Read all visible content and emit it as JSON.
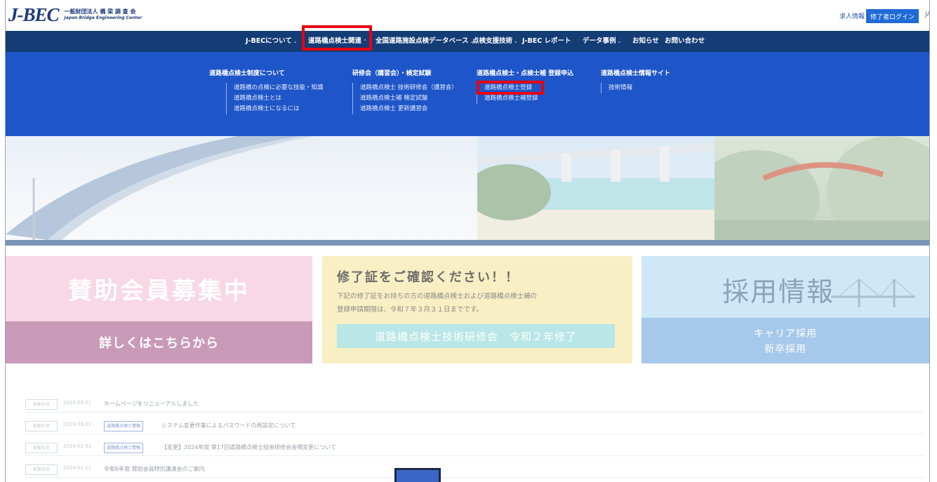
{
  "header": {
    "logo_mark": "J-BEC",
    "logo_jp": "一般財団法人 橋 梁 調 査 会",
    "logo_en": "Japan Bridge Engineering Center",
    "recruit_link": "求人情報",
    "login_button": "修了者ログイン",
    "lang_link": "JA"
  },
  "nav": {
    "items": [
      {
        "label": "J-BECについて",
        "chevron": true
      },
      {
        "label": "道路橋点検士関連",
        "chevron": true,
        "active": true
      },
      {
        "label": "全国道路施設点検データベース",
        "chevron": true
      },
      {
        "label": "点検支援技術",
        "chevron": true
      },
      {
        "label": "J-BEC レポート",
        "chevron": false
      },
      {
        "label": "データ事例",
        "chevron": true
      },
      {
        "label": "お知らせ",
        "chevron": false
      },
      {
        "label": "お問い合わせ",
        "chevron": false
      }
    ]
  },
  "mega_menu": {
    "columns": [
      {
        "heading": "道路橋点検士制度について",
        "items": [
          "道路橋の点検に必要な技能・知識",
          "道路橋点検士とは",
          "道路橋点検士になるには"
        ]
      },
      {
        "heading": "研修会（講習会）・検定試験",
        "items": [
          "道路橋点検士 技術研修会（講習会）",
          "道路橋点検士補 検定試験",
          "道路橋点検士 更新講習会"
        ]
      },
      {
        "heading": "道路橋点検士・点検士補 登録申込",
        "items": [
          "道路橋点検士登録",
          "道路橋点検士補登録"
        ]
      },
      {
        "heading": "道路橋点検士情報サイト",
        "items": [
          "技術情報"
        ]
      }
    ]
  },
  "banners": {
    "sponsor": {
      "title": "賛助会員募集中",
      "link": "詳しくはこちらから"
    },
    "certificate": {
      "title": "修了証をご確認ください！！",
      "body_line1": "下記の修了証をお持ちの方の道路橋点検士および道路橋点検士補の",
      "body_line2": "登録申請期限は、令和７年３月３１日までです。",
      "box": "道路橋点検士技術研修会　令和２年修了"
    },
    "recruit": {
      "title": "採用情報",
      "line1": "キャリア採用",
      "line2": "新卒採用"
    }
  },
  "news": [
    {
      "category": "お知らせ",
      "date": "2024.04.01",
      "tag": "",
      "title": "ホームページをリニューアルしました"
    },
    {
      "category": "お知らせ",
      "date": "2024.03.01",
      "tag": "道路橋点検士情報",
      "title": "システム変更作業によるパスワードの再設定について"
    },
    {
      "category": "お知らせ",
      "date": "2024.02.01",
      "tag": "道路橋点検士情報",
      "title": "【変更】2024年度 第17回道路橋点検士技術研修会会場変更について"
    },
    {
      "category": "お知らせ",
      "date": "2024.01.11",
      "tag": "",
      "title": "令和6年度 賛助会員特別講演会のご案内"
    }
  ],
  "colors": {
    "nav_bg": "#143c75",
    "mega_bg": "#1e55c8",
    "highlight": "#e60012",
    "login_bg": "#1f6ad6"
  }
}
